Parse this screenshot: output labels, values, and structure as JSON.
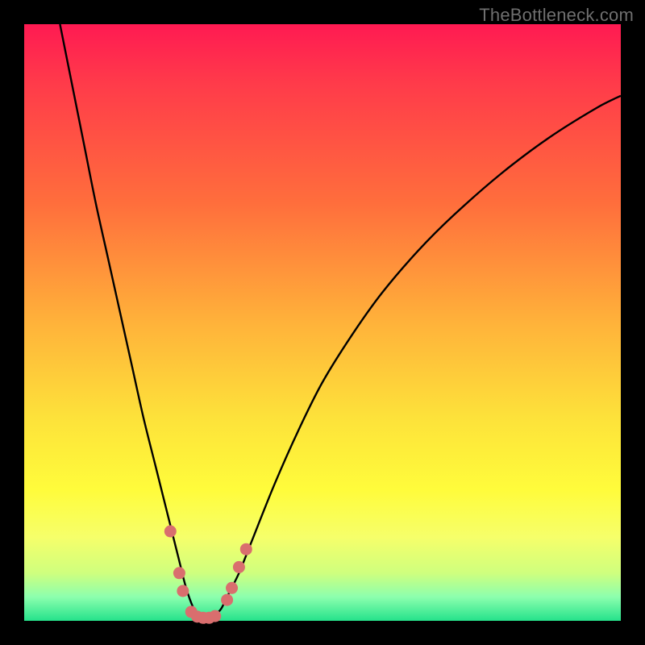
{
  "watermark": "TheBottleneck.com",
  "colors": {
    "frame": "#000000",
    "gradient_top": "#ff1a52",
    "gradient_mid": "#fde23a",
    "gradient_bottom": "#25e28b",
    "curve": "#000000",
    "marker": "#d96e6e"
  },
  "chart_data": {
    "type": "line",
    "title": "",
    "xlabel": "",
    "ylabel": "",
    "xlim": [
      0,
      100
    ],
    "ylim": [
      0,
      100
    ],
    "series": [
      {
        "name": "bottleneck-curve",
        "x": [
          6,
          8,
          10,
          12,
          14,
          16,
          18,
          20,
          22,
          24,
          25,
          26,
          27,
          28,
          29,
          30,
          31,
          32,
          33,
          34,
          36,
          38,
          42,
          46,
          50,
          55,
          60,
          66,
          72,
          80,
          88,
          96,
          100
        ],
        "values": [
          100,
          90,
          80,
          70,
          61,
          52,
          43,
          34,
          26,
          18,
          14,
          10,
          6,
          3,
          1,
          0.5,
          0.5,
          1,
          2,
          4,
          8,
          13,
          23,
          32,
          40,
          48,
          55,
          62,
          68,
          75,
          81,
          86,
          88
        ]
      }
    ],
    "markers": [
      {
        "x": 24.5,
        "y": 15
      },
      {
        "x": 26.0,
        "y": 8
      },
      {
        "x": 26.6,
        "y": 5
      },
      {
        "x": 28.0,
        "y": 1.5
      },
      {
        "x": 29.0,
        "y": 0.7
      },
      {
        "x": 30.0,
        "y": 0.5
      },
      {
        "x": 31.0,
        "y": 0.5
      },
      {
        "x": 32.0,
        "y": 0.8
      },
      {
        "x": 34.0,
        "y": 3.5
      },
      {
        "x": 34.8,
        "y": 5.5
      },
      {
        "x": 36.0,
        "y": 9
      },
      {
        "x": 37.2,
        "y": 12
      }
    ]
  }
}
